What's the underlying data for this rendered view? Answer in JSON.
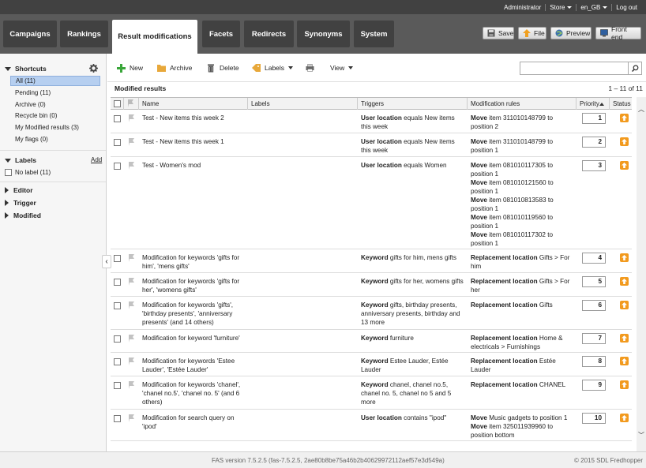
{
  "topbar": {
    "user": "Administrator",
    "store": "Store",
    "locale": "en_GB",
    "logout": "Log out"
  },
  "nav": {
    "tabs": [
      "Campaigns",
      "Rankings",
      "Result modifications",
      "Facets",
      "Redirects",
      "Synonyms",
      "System"
    ],
    "active_tab": "Result modifications",
    "actions": {
      "save": "Save",
      "file": "File",
      "preview": "Preview",
      "frontend": "Front end"
    }
  },
  "sidebar": {
    "shortcuts_title": "Shortcuts",
    "shortcuts": [
      "All (11)",
      "Pending (11)",
      "Archive (0)",
      "Recycle bin (0)",
      "My Modified results (3)",
      "My flags (0)"
    ],
    "labels_title": "Labels",
    "labels_add": "Add",
    "labels": [
      "No label (11)"
    ],
    "editor": "Editor",
    "trigger": "Trigger",
    "modified": "Modified"
  },
  "toolbar": {
    "new": "New",
    "archive": "Archive",
    "delete": "Delete",
    "labels": "Labels",
    "view": "View",
    "search_placeholder": ""
  },
  "list": {
    "title": "Modified results",
    "count": "1 – 11 of 11",
    "columns": {
      "name": "Name",
      "labels": "Labels",
      "triggers": "Triggers",
      "rules": "Modification rules",
      "priority": "Priority",
      "status": "Status"
    },
    "rows": [
      {
        "name": "Test - New items this week 2",
        "trig_b": "User location",
        "trig_t": " equals New items this week",
        "rules": [
          {
            "b": "Move",
            "t": " item 311010148799 to position 2"
          }
        ],
        "priority": "1"
      },
      {
        "name": "Test - New items this week 1",
        "trig_b": "User location",
        "trig_t": " equals New items this week",
        "rules": [
          {
            "b": "Move",
            "t": " item 311010148799 to position 1"
          }
        ],
        "priority": "2"
      },
      {
        "name": "Test - Women's mod",
        "trig_b": "User location",
        "trig_t": " equals Women",
        "rules": [
          {
            "b": "Move",
            "t": " item 081010117305 to position 1"
          },
          {
            "b": "Move",
            "t": " item 081010121560 to position 1"
          },
          {
            "b": "Move",
            "t": " item 081010813583 to position 1"
          },
          {
            "b": "Move",
            "t": " item 081010119560 to position 1"
          },
          {
            "b": "Move",
            "t": " item 081010117302 to position 1"
          }
        ],
        "priority": "3"
      },
      {
        "name": "Modification for keywords 'gifts for him', 'mens gifts'",
        "trig_b": "Keyword",
        "trig_t": " gifts for him, mens gifts",
        "rules": [
          {
            "b": "Replacement location",
            "t": " Gifts > For him"
          }
        ],
        "priority": "4"
      },
      {
        "name": "Modification for keywords 'gifts for her', 'womens gifts'",
        "trig_b": "Keyword",
        "trig_t": " gifts for her, womens gifts",
        "rules": [
          {
            "b": "Replacement location",
            "t": " Gifts > For her"
          }
        ],
        "priority": "5"
      },
      {
        "name": "Modification for keywords 'gifts', 'birthday presents', 'anniversary presents' (and 14 others)",
        "trig_b": "Keyword",
        "trig_t": " gifts, birthday presents, anniversary presents, birthday and 13 more",
        "rules": [
          {
            "b": "Replacement location",
            "t": " Gifts"
          }
        ],
        "priority": "6"
      },
      {
        "name": "Modification for keyword 'furniture'",
        "trig_b": "Keyword",
        "trig_t": " furniture",
        "rules": [
          {
            "b": "Replacement location",
            "t": " Home & electricals > Furnishings"
          }
        ],
        "priority": "7"
      },
      {
        "name": "Modification for keywords 'Estee Lauder', 'Estée Lauder'",
        "trig_b": "Keyword",
        "trig_t": " Estee Lauder, Estée Lauder",
        "rules": [
          {
            "b": "Replacement location",
            "t": " Estée Lauder"
          }
        ],
        "priority": "8"
      },
      {
        "name": "Modification for keywords 'chanel', 'chanel no.5', 'chanel no. 5' (and 6 others)",
        "trig_b": "Keyword",
        "trig_t": " chanel, chanel no.5, chanel no. 5, chanel no 5 and 5 more",
        "rules": [
          {
            "b": "Replacement location",
            "t": " CHANEL"
          }
        ],
        "priority": "9"
      },
      {
        "name": "Modification for search query on 'ipod'",
        "trig_b": "User location",
        "trig_t": " contains \"ipod\"",
        "rules": [
          {
            "b": "Move",
            "t": " Music gadgets  to position 1"
          },
          {
            "b": "Move",
            "t": " item 325011939960 to position bottom"
          }
        ],
        "priority": "10"
      }
    ]
  },
  "footer": {
    "version": "FAS version 7.5.2.5 (fas-7.5.2.5, 2ae80b8be75a46b2b40629972112aef57e3d549a)",
    "copyright": "© 2015 SDL Fredhopper"
  },
  "colors": {
    "status_orange": "#f29a1e",
    "nav_bg": "#5a5a5a",
    "selected_item": "#b6cff0"
  }
}
